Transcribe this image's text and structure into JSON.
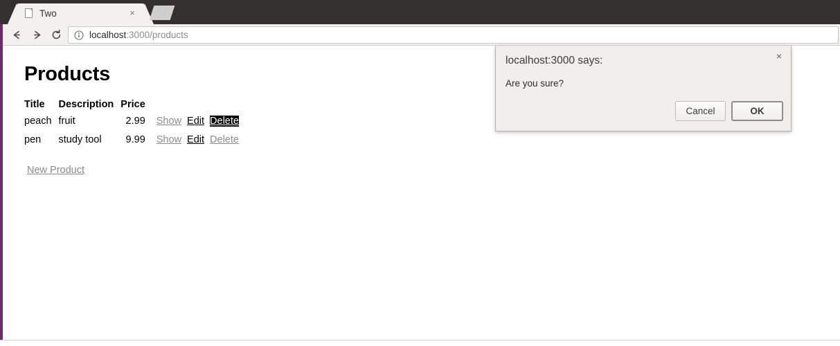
{
  "browser": {
    "tab": {
      "title": "Two",
      "favicon": "document-icon",
      "close_label": "×"
    },
    "new_tab_label": "",
    "nav": {
      "back": "back-arrow-icon",
      "forward": "forward-arrow-icon",
      "reload": "reload-icon"
    },
    "omnibox": {
      "security_icon": "info-circle-icon",
      "url_host": "localhost",
      "url_rest": ":3000/products",
      "url_full": "localhost:3000/products"
    }
  },
  "page": {
    "title": "Products",
    "table": {
      "headers": [
        "Title",
        "Description",
        "Price",
        "",
        "",
        ""
      ],
      "rows": [
        {
          "title": "peach",
          "description": "fruit",
          "price": "2.99",
          "show": "Show",
          "edit": "Edit",
          "delete": "Delete"
        },
        {
          "title": "pen",
          "description": "study tool",
          "price": "9.99",
          "show": "Show",
          "edit": "Edit",
          "delete": "Delete"
        }
      ]
    },
    "new_product_link": "New Product"
  },
  "dialog": {
    "title": "localhost:3000 says:",
    "message": "Are you sure?",
    "cancel_label": "Cancel",
    "ok_label": "OK",
    "close_label": "×"
  },
  "colors": {
    "window_border": "#71296b",
    "tabstrip": "#34302d",
    "toolbar": "#f2f1f0",
    "dialog_bg": "#f0efee",
    "muted_link": "#8a8a8a",
    "selection_bg": "#000000",
    "selection_fg": "#ffffff"
  }
}
